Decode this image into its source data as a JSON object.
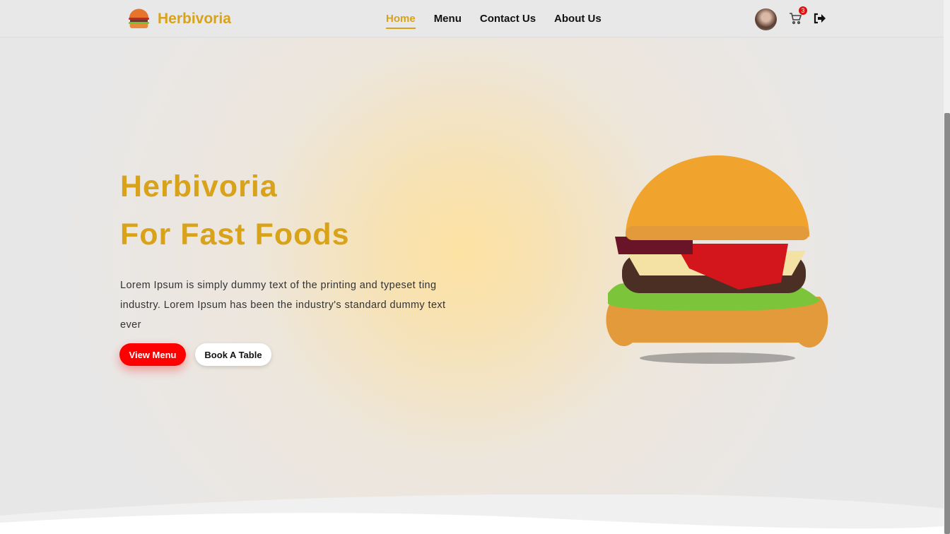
{
  "brand": {
    "name": "Herbivoria"
  },
  "nav": {
    "items": [
      "Home",
      "Menu",
      "Contact Us",
      "About Us"
    ],
    "active": "Home"
  },
  "cart": {
    "count": "3"
  },
  "hero": {
    "title_line1": "Herbivoria",
    "title_line2": "For Fast Foods",
    "description": "Lorem Ipsum is simply dummy text of the printing and typeset ting industry. Lorem Ipsum has been the industry's standard dummy text ever",
    "primary_button": "View Menu",
    "secondary_button": "Book A Table"
  },
  "colors": {
    "accent": "#d8a31a",
    "primary": "#ff0000"
  }
}
